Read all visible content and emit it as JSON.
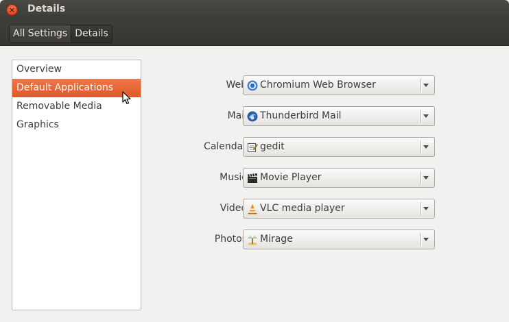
{
  "window": {
    "title": "Details"
  },
  "breadcrumb": {
    "items": [
      {
        "label": "All Settings"
      },
      {
        "label": "Details"
      }
    ]
  },
  "sidebar": {
    "selected": "Default Applications",
    "items": [
      {
        "label": "Overview"
      },
      {
        "label": "Default Applications"
      },
      {
        "label": "Removable Media"
      },
      {
        "label": "Graphics"
      }
    ]
  },
  "defaults": {
    "rows": [
      {
        "label": "Web",
        "value": "Chromium Web Browser",
        "icon": "chromium-icon"
      },
      {
        "label": "Mail",
        "value": "Thunderbird Mail",
        "icon": "thunderbird-icon"
      },
      {
        "label": "Calendar",
        "value": "gedit",
        "icon": "gedit-icon"
      },
      {
        "label": "Music",
        "value": "Movie Player",
        "icon": "movie-player-icon"
      },
      {
        "label": "Video",
        "value": "VLC media player",
        "icon": "vlc-icon"
      },
      {
        "label": "Photos",
        "value": "Mirage",
        "icon": "mirage-icon"
      }
    ]
  },
  "colors": {
    "accent": "#e95420",
    "titlebar": "#3c3b37"
  }
}
